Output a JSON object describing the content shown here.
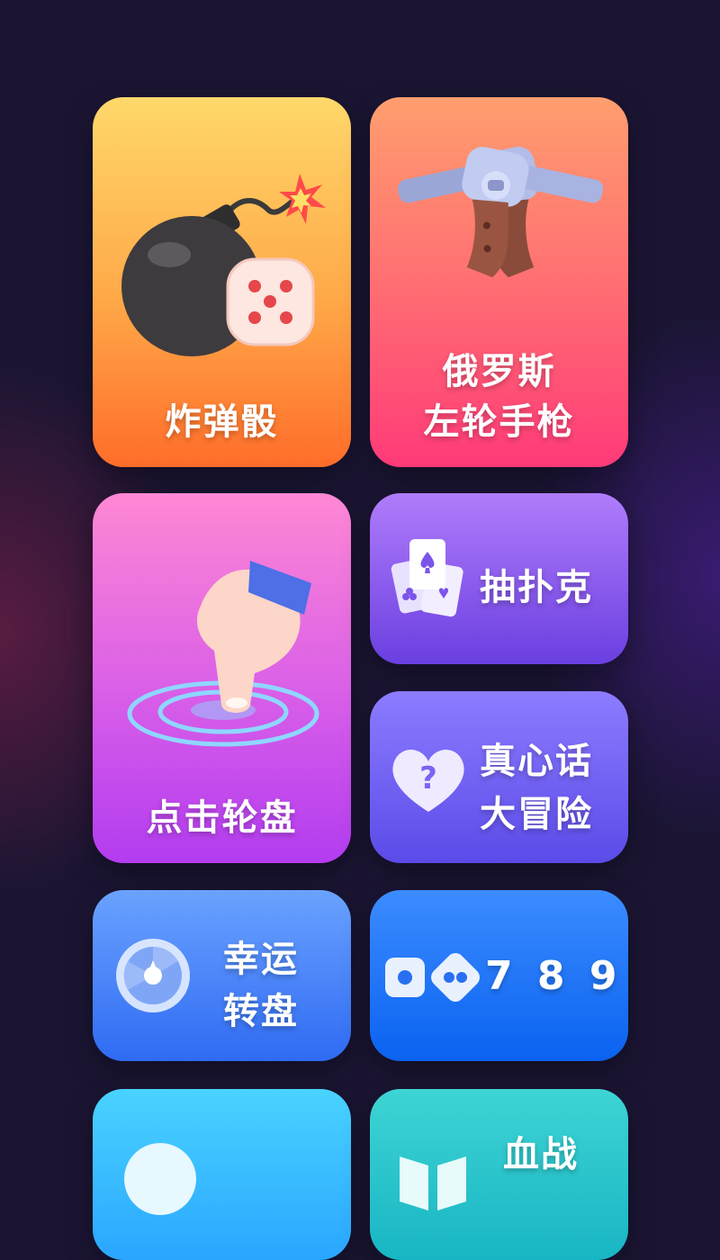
{
  "games": {
    "bomb_dice": {
      "label": "炸弹骰"
    },
    "russian_roulette": {
      "line1": "俄罗斯",
      "line2": "左轮手枪"
    },
    "tap_wheel": {
      "label": "点击轮盘"
    },
    "draw_poker": {
      "label": "抽扑克"
    },
    "truth_dare": {
      "line1": "真心话",
      "line2": "大冒险"
    },
    "lucky_wheel": {
      "line1": "幸运",
      "line2": "转盘"
    },
    "game_789": {
      "label": "7 8 9"
    },
    "bottom_right": {
      "line1": "血战"
    }
  },
  "colors": {
    "background": "#1b1533",
    "bomb_dice": [
      "#ffd86a",
      "#ff6d2a"
    ],
    "russian_roulette": [
      "#ff9e6e",
      "#ff3a78"
    ],
    "tap_wheel": [
      "#ff88d4",
      "#b33cf0"
    ],
    "draw_poker": [
      "#b07cfb",
      "#6a3fe0"
    ],
    "truth_dare": [
      "#8c7cff",
      "#5b4be8"
    ],
    "lucky_wheel": [
      "#6aa2ff",
      "#2f6bf3"
    ],
    "game_789": [
      "#3c8cff",
      "#0a62f0"
    ],
    "bottom_left": [
      "#49d3ff",
      "#2aa6ff"
    ],
    "bottom_right": [
      "#3ed4d4",
      "#18b5c4"
    ]
  }
}
